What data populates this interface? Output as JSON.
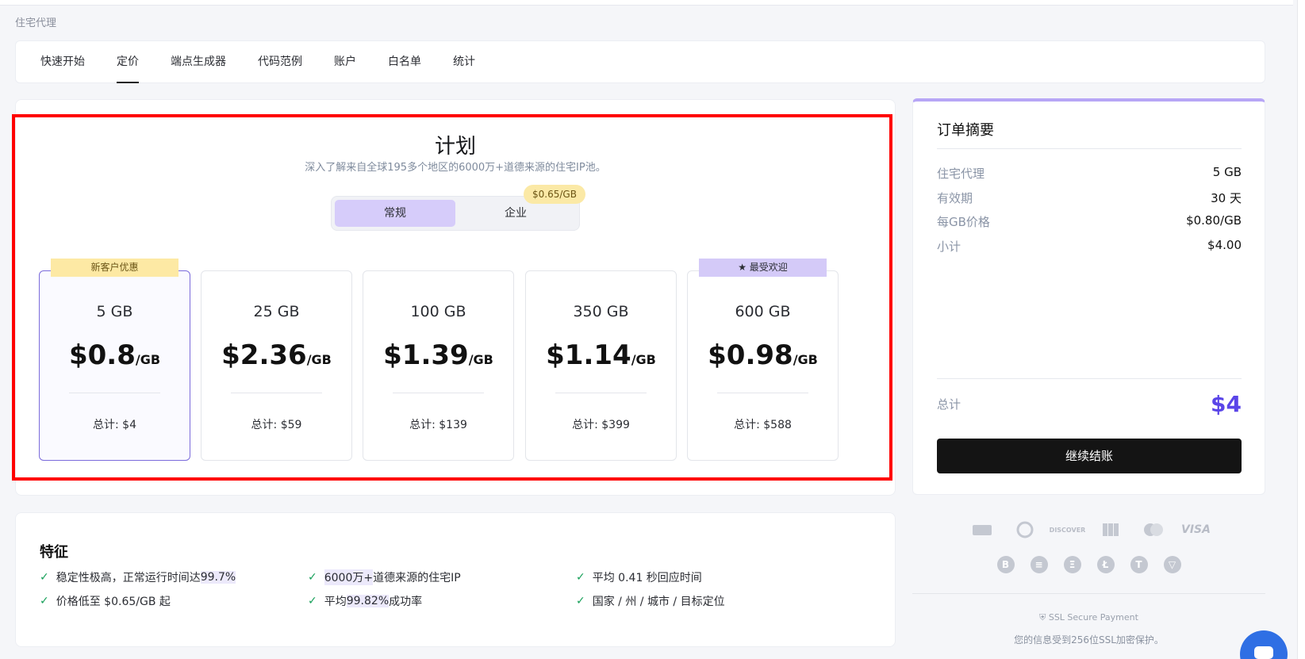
{
  "breadcrumb": "住宅代理",
  "tabs": [
    {
      "label": "快速开始"
    },
    {
      "label": "定价"
    },
    {
      "label": "端点生成器"
    },
    {
      "label": "代码范例"
    },
    {
      "label": "账户"
    },
    {
      "label": "白名单"
    },
    {
      "label": "统计"
    }
  ],
  "plan": {
    "title": "计划",
    "subtitle": "深入了解来自全球195多个地区的6000万+道德来源的住宅IP池。",
    "toggle": {
      "regular": "常规",
      "enterprise": "企业",
      "enterprise_badge": "$0.65/GB"
    },
    "cards": [
      {
        "gb": "5 GB",
        "price": "$0.8",
        "unit": "/GB",
        "total": "总计: $4",
        "tag": "新客户优惠"
      },
      {
        "gb": "25 GB",
        "price": "$2.36",
        "unit": "/GB",
        "total": "总计: $59"
      },
      {
        "gb": "100 GB",
        "price": "$1.39",
        "unit": "/GB",
        "total": "总计: $139"
      },
      {
        "gb": "350 GB",
        "price": "$1.14",
        "unit": "/GB",
        "total": "总计: $399"
      },
      {
        "gb": "600 GB",
        "price": "$0.98",
        "unit": "/GB",
        "total": "总计: $588",
        "tag": "最受欢迎"
      }
    ]
  },
  "features": {
    "title": "特征",
    "items": [
      {
        "pre": "稳定性极高，正常运行时间达 ",
        "hl": "99.7%",
        "post": ""
      },
      {
        "pre": "",
        "hl": "6000万+",
        "post": "道德来源的住宅IP"
      },
      {
        "pre": "平均 0.41 秒回应时间",
        "hl": "",
        "post": ""
      },
      {
        "pre": "价格低至 $0.65/GB 起",
        "hl": "",
        "post": ""
      },
      {
        "pre": "平均",
        "hl": "99.82%",
        "post": " 成功率"
      },
      {
        "pre": "国家 / 州 / 城市 / 目标定位",
        "hl": "",
        "post": ""
      }
    ]
  },
  "order": {
    "title": "订单摘要",
    "rows": [
      {
        "k": "住宅代理",
        "v": "5 GB"
      },
      {
        "k": "有效期",
        "v": "30 天"
      },
      {
        "k": "每GB价格",
        "v": "$0.80/GB"
      },
      {
        "k": "小计",
        "v": "$4.00"
      }
    ],
    "total_label": "总计",
    "total_value": "$4",
    "checkout": "继续结账"
  },
  "payments": {
    "cards": [
      "AMEX",
      "DINERS",
      "DISCOVER",
      "JCB",
      "MASTERCARD",
      "VISA"
    ],
    "card_text": [
      "",
      "",
      "DISCOVER",
      "",
      "",
      "VISA"
    ],
    "crypto": [
      "B",
      "≡",
      "Ξ",
      "Ł",
      "T",
      "▽"
    ],
    "ssl": "SSL Secure Payment",
    "note": "您的信息受到256位SSL加密保护。"
  }
}
